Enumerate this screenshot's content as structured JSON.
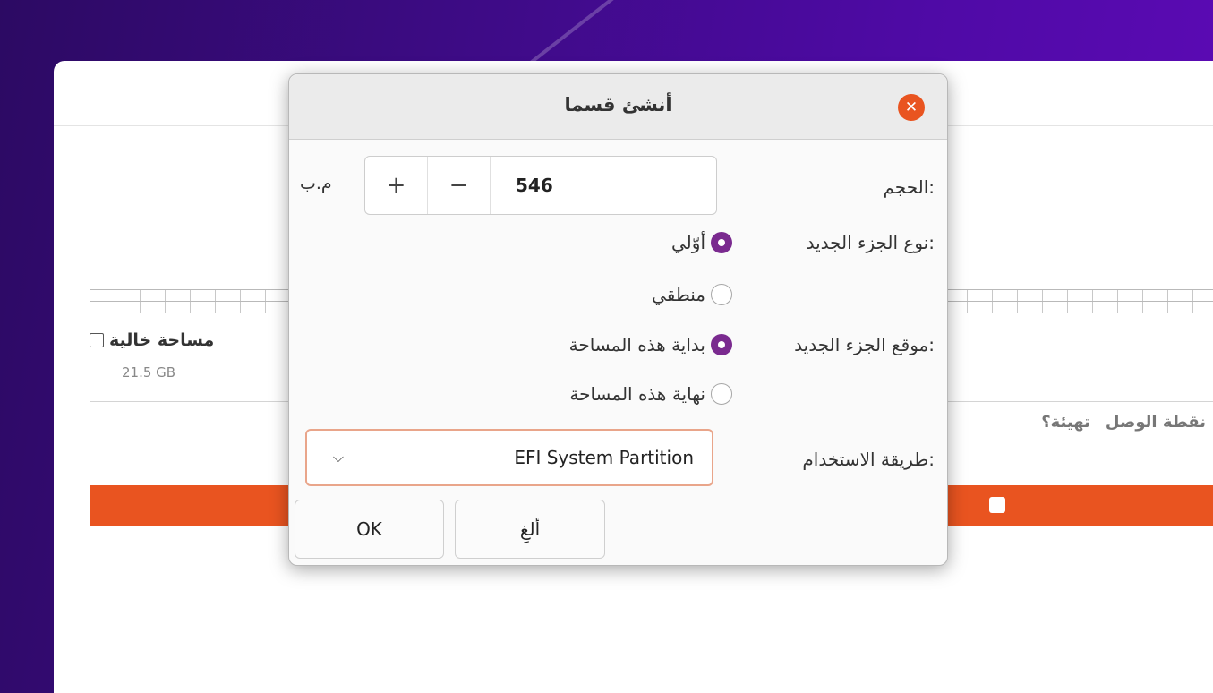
{
  "background": {
    "free_space_label": "مساحة خالية",
    "free_space_size": "21.5 GB",
    "table_headers": [
      "نقطة الوصل",
      "تهيئة؟"
    ]
  },
  "dialog": {
    "title": "أنشئ قسما",
    "size_label": "الحجم:",
    "size_value": "546",
    "size_unit": "م.ب",
    "plus_symbol": "+",
    "minus_symbol": "−",
    "type_label": "نوع الجزء الجديد:",
    "type_primary": "أوّلي",
    "type_logical": "منطقي",
    "location_label": "موقع الجزء الجديد:",
    "location_beginning": "بداية هذه المساحة",
    "location_end": "نهاية هذه المساحة",
    "use_as_label": "طريقة الاستخدام:",
    "use_as_value": "EFI System Partition",
    "cancel_button": "ألغِ",
    "ok_button": "OK"
  },
  "colors": {
    "accent": "#e95420",
    "radio_selected": "#7a2a8f"
  }
}
